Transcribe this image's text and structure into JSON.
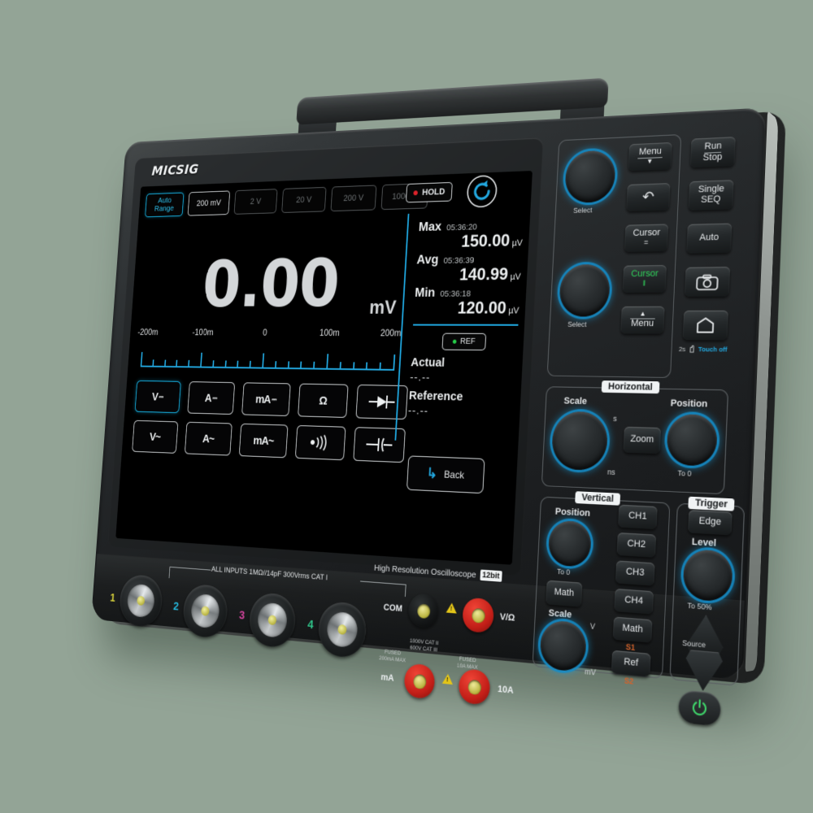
{
  "product": {
    "brand": "MICSIG",
    "model_line": "High Resolution Oscilloscope",
    "bit_badge": "12bit"
  },
  "screen": {
    "range_buttons": [
      {
        "label_top": "Auto",
        "label_bottom": "Range",
        "state": "active"
      },
      {
        "label": "200 mV",
        "state": "selected"
      },
      {
        "label": "2 V",
        "state": "dim"
      },
      {
        "label": "20 V",
        "state": "dim"
      },
      {
        "label": "200 V",
        "state": "dim"
      },
      {
        "label": "1000 V",
        "state": "dim"
      }
    ],
    "hold_label": "HOLD",
    "refresh_icon": "refresh-icon",
    "reading": {
      "value": "0.00",
      "unit": "mV"
    },
    "scale": {
      "labels": [
        "-200m",
        "-100m",
        "0",
        "100m",
        "200m"
      ],
      "min": -200,
      "max": 200,
      "major_count": 5,
      "minor_per_major": 5
    },
    "stats": [
      {
        "label": "Max",
        "time": "05:36:20",
        "value": "150.00",
        "unit": "µV"
      },
      {
        "label": "Avg",
        "time": "05:36:39",
        "value": "140.99",
        "unit": "µV"
      },
      {
        "label": "Min",
        "time": "05:36:18",
        "value": "120.00",
        "unit": "µV"
      }
    ],
    "ref": {
      "button_label": "REF",
      "actual_label": "Actual",
      "actual_value": "--.--",
      "reference_label": "Reference",
      "reference_value": "--.--"
    },
    "functions": [
      {
        "glyph": "V",
        "mark": "dc",
        "name": "volts-dc",
        "state": "active"
      },
      {
        "glyph": "A",
        "mark": "dc",
        "name": "amps-dc",
        "state": "idle"
      },
      {
        "glyph": "mA",
        "mark": "dc",
        "name": "milliamps-dc",
        "state": "idle"
      },
      {
        "glyph": "Ω",
        "mark": "none",
        "name": "resistance",
        "state": "idle"
      },
      {
        "glyph": "➜❙",
        "mark": "none",
        "name": "diode-test",
        "state": "idle"
      },
      {
        "glyph": "V~",
        "mark": "none",
        "name": "volts-ac",
        "state": "idle"
      },
      {
        "glyph": "A~",
        "mark": "none",
        "name": "amps-ac",
        "state": "idle"
      },
      {
        "glyph": "mA~",
        "mark": "none",
        "name": "milliamps-ac",
        "state": "idle"
      },
      {
        "glyph": "⦷))",
        "mark": "none",
        "name": "continuity",
        "state": "idle"
      },
      {
        "glyph": "–|‹",
        "mark": "none",
        "name": "capacitance",
        "state": "idle"
      }
    ],
    "back_button": "Back"
  },
  "controls": {
    "select_knobs": [
      {
        "label": "Select"
      },
      {
        "label": "Select"
      }
    ],
    "menu_buttons": [
      {
        "label": "Menu",
        "arrow": "▼",
        "name": "menu-down-button"
      },
      {
        "label": "↶",
        "name": "return-button"
      },
      {
        "label": "Cursor",
        "sub": "=",
        "name": "cursor-equal-button"
      },
      {
        "label": "Cursor",
        "sub": "‖",
        "name": "cursor-parallel-button",
        "accent": "#2fd15a"
      },
      {
        "label": "Menu",
        "arrow": "▲",
        "name": "menu-up-button"
      }
    ],
    "action_buttons": [
      {
        "line1": "Run",
        "line2": "Stop",
        "name": "run-stop-button"
      },
      {
        "line1": "Single",
        "line2": "SEQ",
        "name": "single-seq-button"
      },
      {
        "line1": "Auto",
        "name": "auto-button"
      },
      {
        "line1": "□",
        "name": "screenshot-button"
      },
      {
        "line1": "⌂",
        "name": "home-button"
      }
    ],
    "touch_off": {
      "prefix": "2s",
      "label": "Touch off"
    },
    "horizontal": {
      "title": "Horizontal",
      "scale_label": "Scale",
      "scale_max": "s",
      "scale_min": "ns",
      "zoom_label": "Zoom",
      "position_label": "Position",
      "position_sub": "To 0"
    },
    "vertical": {
      "title": "Vertical",
      "position_label": "Position",
      "position_sub": "To 0",
      "math_label": "Math",
      "scale_label": "Scale",
      "scale_max": "V",
      "scale_min": "mV",
      "channels": [
        {
          "label": "CH1"
        },
        {
          "label": "CH2"
        },
        {
          "label": "CH3"
        },
        {
          "label": "CH4"
        },
        {
          "label": "Math",
          "sub": "S1"
        },
        {
          "label": "Ref",
          "sub": "S2"
        }
      ]
    },
    "trigger": {
      "title": "Trigger",
      "edge_label": "Edge",
      "level_label": "Level",
      "level_sub": "To 50%",
      "source_label": "Source"
    },
    "power_label": "power-button"
  },
  "front_panel": {
    "inputs_note": "ALL INPUTS 1MΩ//14pF 300Vrms CAT I",
    "channels": [
      {
        "num": "1",
        "color": "#d8d23a"
      },
      {
        "num": "2",
        "color": "#24b5d8"
      },
      {
        "num": "3",
        "color": "#d martin"
      },
      {
        "num": "4",
        "color": "#2fc48a"
      }
    ],
    "jacks": [
      {
        "label": "COM",
        "type": "black",
        "name": "com-jack"
      },
      {
        "label": "V/Ω",
        "type": "red",
        "name": "voltage-ohm-jack"
      },
      {
        "label": "mA",
        "type": "red",
        "name": "milliamp-jack"
      },
      {
        "label": "10A",
        "type": "red",
        "name": "ten-amp-jack"
      }
    ],
    "fuse_notes": {
      "left": "FUSED\n200mA MAX",
      "right": "FUSED\n10A MAX",
      "cat": "1000V CAT II\n600V CAT III"
    }
  },
  "colors": {
    "accent_cyan": "#22a8e0",
    "background": "#93a496",
    "green": "#2fd15a",
    "red": "#e0232b"
  }
}
